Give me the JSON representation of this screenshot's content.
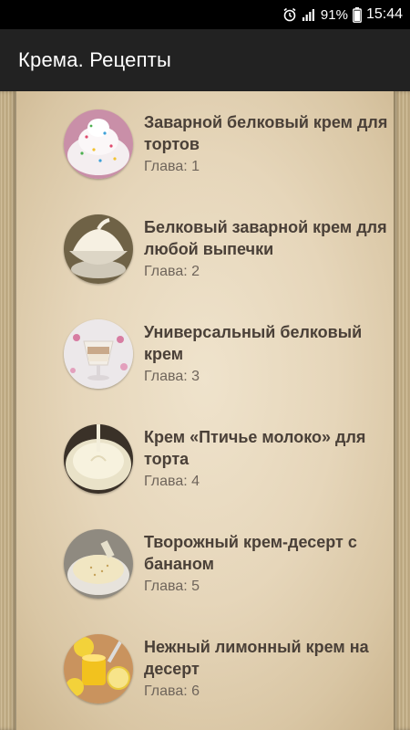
{
  "status_bar": {
    "battery": "91%",
    "time": "15:44",
    "icons": [
      "alarm-icon",
      "signal-icon",
      "battery-icon"
    ]
  },
  "app_bar": {
    "title": "Крема. Рецепты"
  },
  "recipes": [
    {
      "title": "Заварной белковый крем для тортов",
      "chapter": "Глава: 1"
    },
    {
      "title": "Белковый заварной крем для любой выпечки",
      "chapter": "Глава: 2"
    },
    {
      "title": "Универсальный белковый крем",
      "chapter": "Глава: 3"
    },
    {
      "title": "Крем «Птичье молоко» для торта",
      "chapter": "Глава: 4"
    },
    {
      "title": "Творожный крем-десерт с бананом",
      "chapter": "Глава: 5"
    },
    {
      "title": "Нежный лимонный крем на десерт",
      "chapter": "Глава: 6"
    }
  ]
}
